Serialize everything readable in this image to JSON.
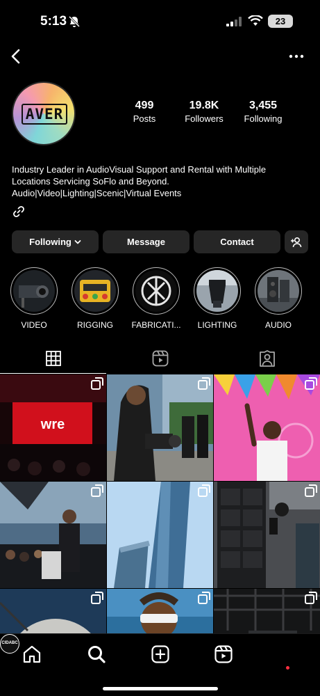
{
  "status_bar": {
    "time": "5:13",
    "battery": "23"
  },
  "profile": {
    "logo_text": "AVER",
    "stats": [
      {
        "value": "499",
        "label": "Posts"
      },
      {
        "value": "19.8K",
        "label": "Followers"
      },
      {
        "value": "3,455",
        "label": "Following"
      }
    ],
    "bio_lines": [
      "Industry Leader in AudioVisual Support and Rental with Multiple",
      "Locations Servicing SoFlo and Beyond.",
      "Audio|Video|Lighting|Scenic|Virtual Events"
    ]
  },
  "buttons": {
    "following": "Following",
    "message": "Message",
    "contact": "Contact"
  },
  "highlights": [
    {
      "label": "VIDEO"
    },
    {
      "label": "RIGGING"
    },
    {
      "label": "FABRICATI..."
    },
    {
      "label": "LIGHTING"
    },
    {
      "label": "AUDIO"
    }
  ],
  "tabs": [
    "grid",
    "reels",
    "tagged"
  ],
  "grid_posts": [
    {
      "scene": "stage-event",
      "text": "wre"
    },
    {
      "scene": "camera-crew"
    },
    {
      "scene": "pink-color-wall"
    },
    {
      "scene": "speaker-at-podium"
    },
    {
      "scene": "skyscraper"
    },
    {
      "scene": "led-wall-rigging"
    },
    {
      "scene": "moon-balloon"
    },
    {
      "scene": "man-in-sunglasses"
    },
    {
      "scene": "truss-equipment"
    }
  ],
  "bottom_nav": {
    "items": [
      "home",
      "search",
      "create",
      "reels",
      "profile"
    ],
    "profile_text": "CIDABC"
  },
  "colors": {
    "background": "#000000",
    "button": "#262626",
    "notification_dot": "#ff3040"
  }
}
